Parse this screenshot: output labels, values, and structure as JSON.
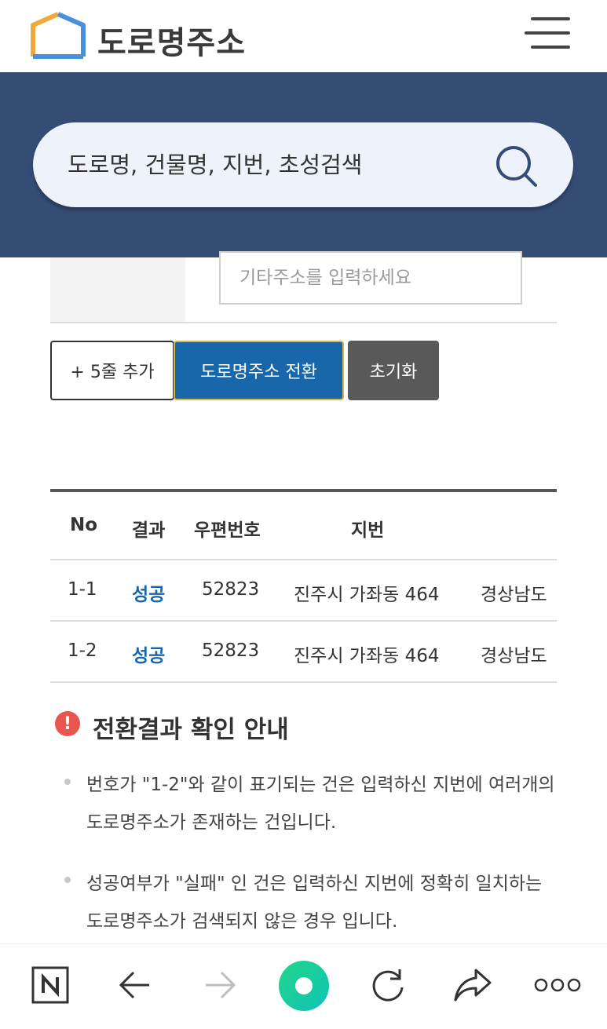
{
  "header": {
    "logo_text": "도로명주소"
  },
  "search": {
    "placeholder": "도로명, 건물명, 지번, 초성검색"
  },
  "form": {
    "etc_placeholder": "기타주소를 입력하세요"
  },
  "buttons": {
    "add_rows": "+ 5줄 추가",
    "convert": "도로명주소 전환",
    "reset": "초기화"
  },
  "table": {
    "headers": {
      "no": "No",
      "result": "결과",
      "zipcode": "우편번호",
      "jibun": "지번"
    },
    "rows": [
      {
        "no": "1-1",
        "result": "성공",
        "zipcode": "52823",
        "jibun": "진주시 가좌동 464",
        "province": "경상남도"
      },
      {
        "no": "1-2",
        "result": "성공",
        "zipcode": "52823",
        "jibun": "진주시 가좌동 464",
        "province": "경상남도"
      }
    ]
  },
  "notice": {
    "title": "전환결과 확인 안내",
    "items": [
      "번호가 \"1-2\"와 같이 표기되는 건은 입력하신 지번에 여러개의 도로명주소가 존재하는 건입니다.",
      "성공여부가 \"실패\" 인 건은 입력하신 지번에 정확히 일치하는 도로명주소가 검색되지 않은 경우 입니다."
    ]
  },
  "colors": {
    "header_band": "#354c75",
    "convert_button": "#1867aa",
    "reset_button": "#595959",
    "success_text": "#1867aa",
    "alert_icon": "#e8564e"
  },
  "icons": {
    "browser_home": "naver-n-icon",
    "back": "arrow-left-icon",
    "forward": "arrow-right-icon",
    "green_dot": "green-circle-icon",
    "reload": "reload-icon",
    "share": "share-icon",
    "more": "more-dots-icon"
  }
}
